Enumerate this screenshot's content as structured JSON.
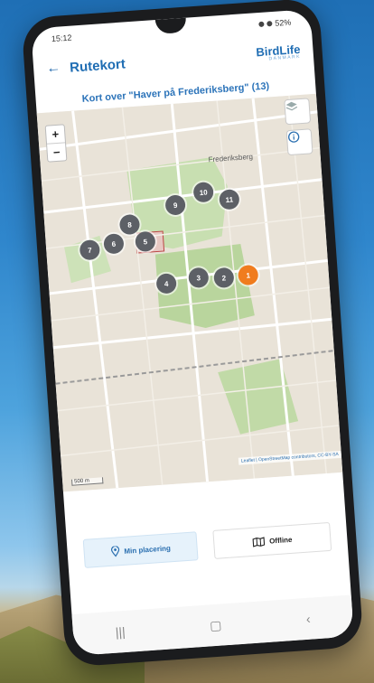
{
  "status_bar": {
    "time": "15:12",
    "battery": "52%"
  },
  "app_bar": {
    "back_glyph": "←",
    "title": "Rutekort",
    "brand_main": "BirdLife",
    "brand_sub": "DANMARK"
  },
  "map_title": "Kort over \"Haver på Frederiksberg\" (13)",
  "map": {
    "zoom_in": "+",
    "zoom_out": "−",
    "label_area": "Frederiksberg",
    "scale": "500 m",
    "attribution": "Leaflet | OpenStreetMap contributors, CC-BY-SA",
    "markers": [
      {
        "label": "1",
        "active": true
      },
      {
        "label": "2",
        "active": false
      },
      {
        "label": "3",
        "active": false
      },
      {
        "label": "4",
        "active": false
      },
      {
        "label": "5",
        "active": false
      },
      {
        "label": "6",
        "active": false
      },
      {
        "label": "7",
        "active": false
      },
      {
        "label": "8",
        "active": false
      },
      {
        "label": "9",
        "active": false
      },
      {
        "label": "10",
        "active": false
      },
      {
        "label": "11",
        "active": false
      }
    ]
  },
  "buttons": {
    "location": "Min placering",
    "offline": "Offline"
  },
  "nav": {
    "recent": "|||",
    "home": "▢",
    "back": "‹"
  },
  "colors": {
    "accent": "#1f6db3",
    "marker": "#5d6066",
    "marker_active": "#f07c1e"
  }
}
